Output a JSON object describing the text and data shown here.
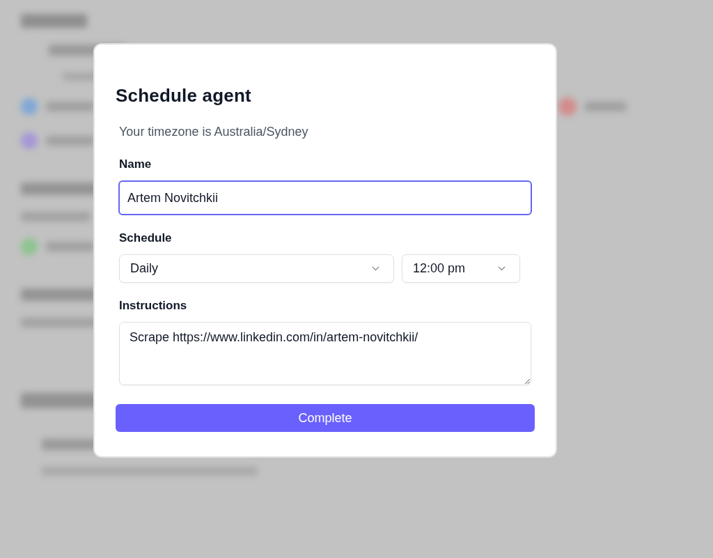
{
  "dialog": {
    "title": "Schedule agent",
    "timezone_note": "Your timezone is Australia/Sydney",
    "fields": [
      {
        "kind": "text",
        "label": "Name",
        "value": "Artem Novitchkii",
        "focused": true
      },
      {
        "kind": "select_pair",
        "label": "Schedule",
        "selects": [
          {
            "value": "Daily"
          },
          {
            "value": "12:00 pm"
          }
        ]
      },
      {
        "kind": "textarea",
        "label": "Instructions",
        "value": "Scrape https://www.linkedin.com/in/artem-novitchkii/"
      }
    ],
    "submit_button": "Complete"
  }
}
